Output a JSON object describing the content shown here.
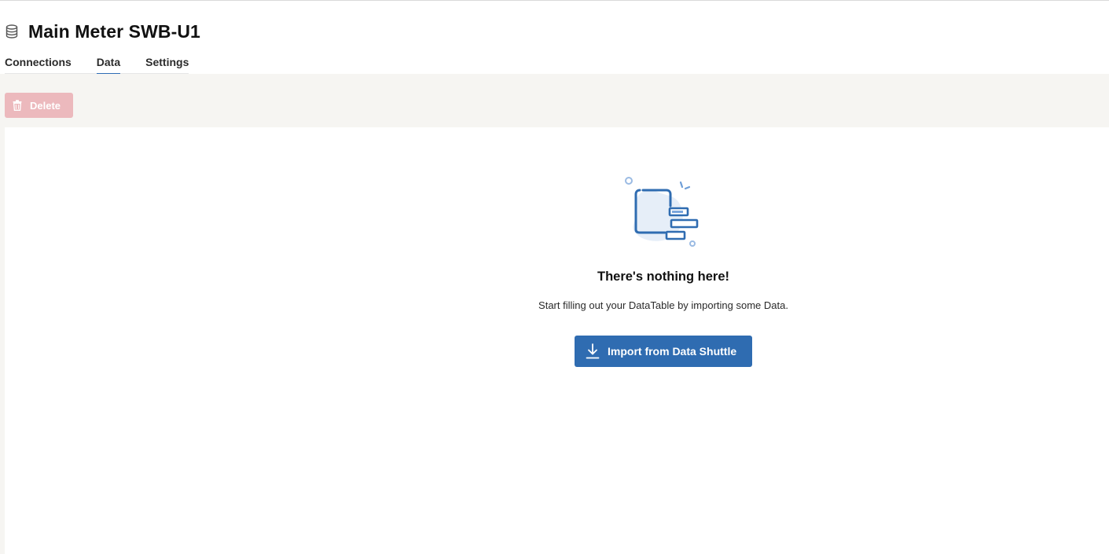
{
  "page": {
    "title": "Main Meter SWB-U1",
    "title_icon": "database-icon"
  },
  "tabs": [
    {
      "label": "Connections",
      "active": false
    },
    {
      "label": "Data",
      "active": true
    },
    {
      "label": "Settings",
      "active": false
    }
  ],
  "toolbar": {
    "delete_label": "Delete",
    "delete_icon": "trash-icon",
    "delete_disabled": true
  },
  "empty_state": {
    "illustration": "datatable-empty-illustration",
    "title": "There's nothing here!",
    "description": "Start filling out your DataTable by importing some Data.",
    "import_label": "Import from Data Shuttle",
    "import_icon": "download-icon"
  },
  "colors": {
    "accent": "#2f6cb1",
    "delete_disabled_bg": "#ecb9bd",
    "toolbar_bg": "#f6f5f2"
  }
}
